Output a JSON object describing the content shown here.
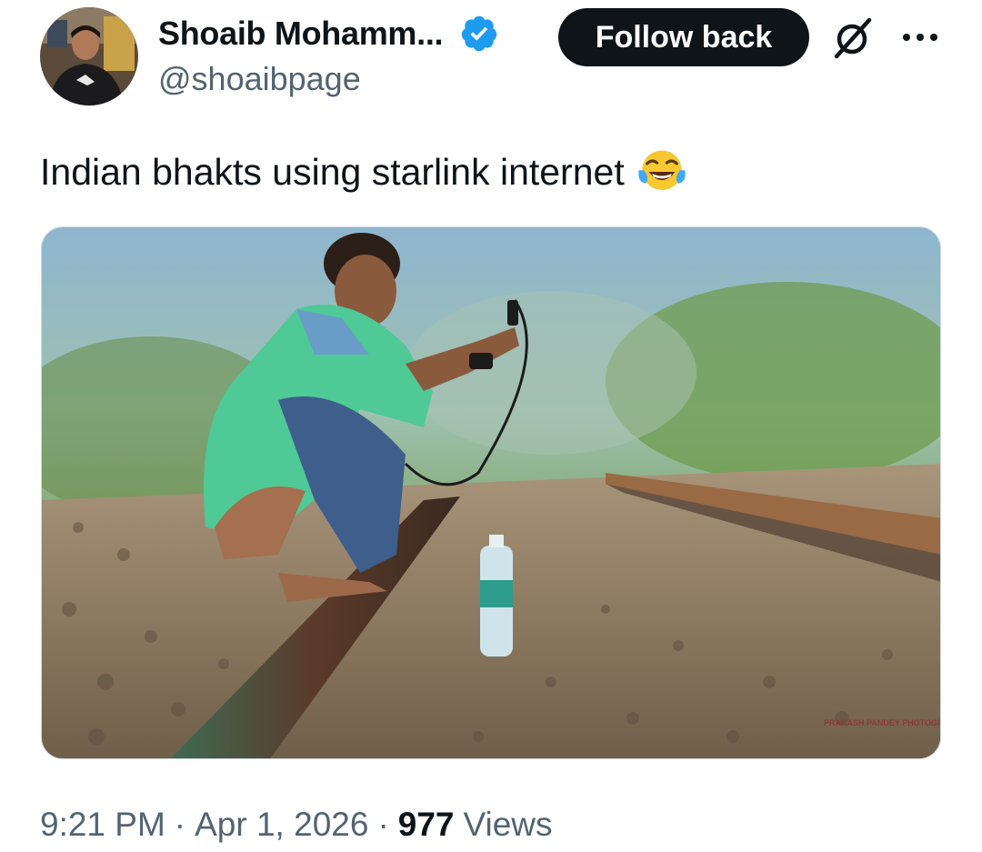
{
  "author": {
    "display_name": "Shoaib Mohamm...",
    "handle": "@shoaibpage",
    "verified_icon": "verified-badge-icon",
    "verified_color": "#1d9bf0"
  },
  "actions": {
    "follow_label": "Follow back",
    "grok_icon": "grok-icon",
    "more_icon": "more-options-icon"
  },
  "tweet": {
    "text": "Indian bhakts using starlink internet",
    "emoji": "face-with-tears-of-joy"
  },
  "media": {
    "watermark": "PRAKASH PANDEY PHOTOGRAPHY"
  },
  "meta": {
    "time": "9:21 PM",
    "date": "Apr 1, 2026",
    "separator": "·",
    "views_count": "977",
    "views_label": "Views"
  },
  "colors": {
    "text_primary": "#0f1419",
    "text_secondary": "#536471",
    "button_bg": "#0f1419",
    "accent": "#1d9bf0"
  }
}
